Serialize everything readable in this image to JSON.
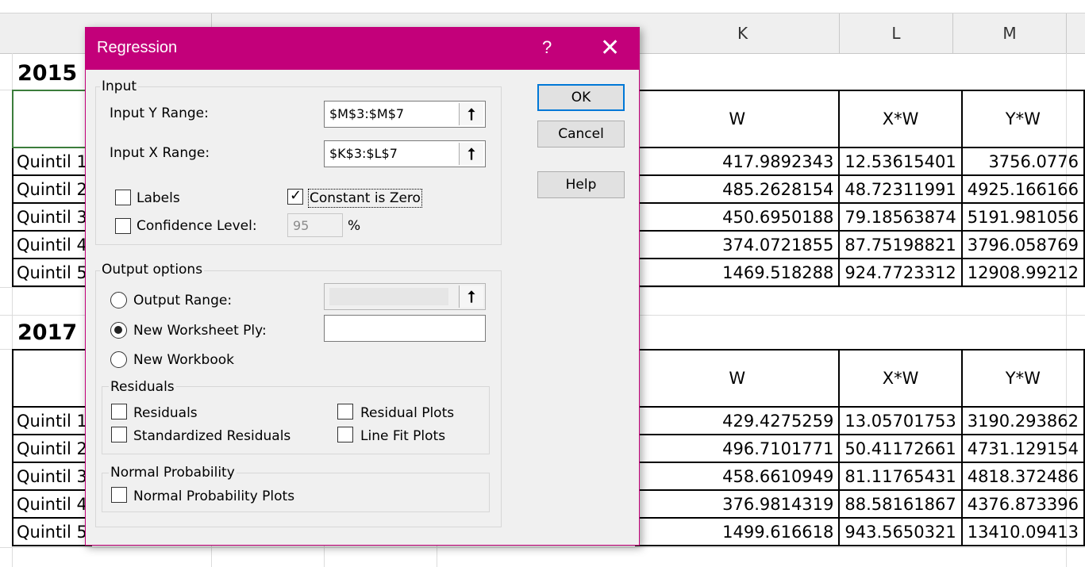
{
  "spreadsheet": {
    "columns": [
      "K",
      "L",
      "M"
    ],
    "years": [
      "2015",
      "2017"
    ],
    "row_labels": [
      "Quintil 1",
      "Quintil 2",
      "Quintil 3",
      "Quintil 4",
      "Quintil 5"
    ],
    "headers": [
      "W",
      "X*W",
      "Y*W"
    ],
    "table_2015": [
      [
        "417.9892343",
        "12.53615401",
        "3756.0776"
      ],
      [
        "485.2628154",
        "48.72311991",
        "4925.166166"
      ],
      [
        "450.6950188",
        "79.18563874",
        "5191.981056"
      ],
      [
        "374.0721855",
        "87.75198821",
        "3796.058769"
      ],
      [
        "1469.518288",
        "924.7723312",
        "12908.99212"
      ]
    ],
    "table_2017": [
      [
        "429.4275259",
        "13.05701753",
        "3190.293862"
      ],
      [
        "496.7101771",
        "50.41172661",
        "4731.129154"
      ],
      [
        "458.6610949",
        "81.11765431",
        "4818.372486"
      ],
      [
        "376.9814319",
        "88.58161867",
        "4376.873396"
      ],
      [
        "1499.616618",
        "943.5650321",
        "13410.09413"
      ]
    ]
  },
  "dialog": {
    "title": "Regression",
    "help_glyph": "?",
    "close_glyph": "✕",
    "input_group": "Input",
    "input_y_label": "Input Y Range:",
    "input_y_value": "$M$3:$M$7",
    "input_x_label": "Input X Range:",
    "input_x_value": "$K$3:$L$7",
    "collapse_glyph": "⭡",
    "labels_label": "Labels",
    "labels_checked": false,
    "constant_zero_label": "Constant is Zero",
    "constant_zero_checked": true,
    "confidence_label": "Confidence Level:",
    "confidence_value": "95",
    "percent": "%",
    "output_group": "Output options",
    "output_range_label": "Output Range:",
    "new_ply_label": "New Worksheet Ply:",
    "new_workbook_label": "New Workbook",
    "selected_output": "New Worksheet Ply",
    "residuals_group": "Residuals",
    "residuals_label": "Residuals",
    "std_residuals_label": "Standardized Residuals",
    "residual_plots_label": "Residual Plots",
    "line_fit_label": "Line Fit Plots",
    "normal_group": "Normal Probability",
    "normal_plots_label": "Normal Probability Plots",
    "ok": "OK",
    "cancel": "Cancel",
    "help": "Help"
  }
}
